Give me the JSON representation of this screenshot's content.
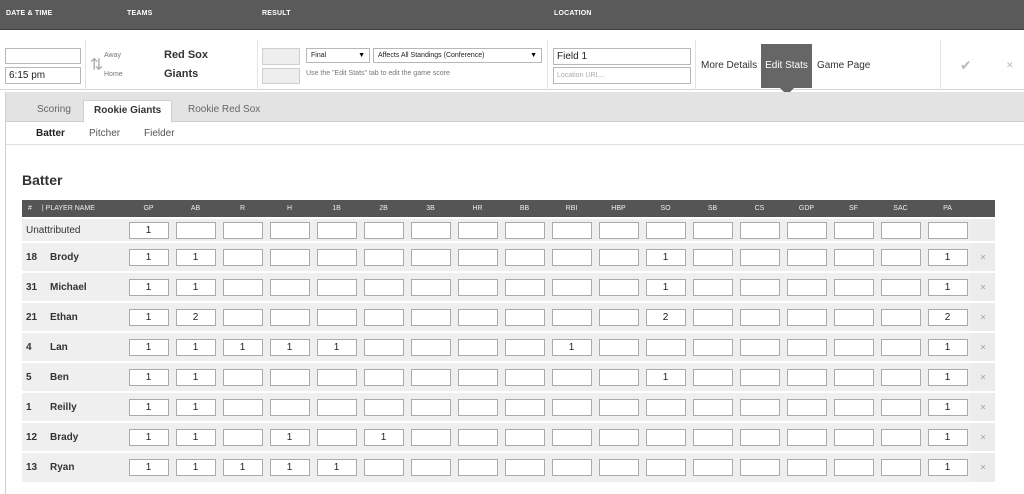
{
  "header": {
    "date_time": "DATE & TIME",
    "teams": "TEAMS",
    "result": "RESULT",
    "location": "LOCATION"
  },
  "game": {
    "date_value": "",
    "time_value": "6:15 pm",
    "away_label": "Away",
    "home_label": "Home",
    "away_team": "Red Sox",
    "home_team": "Giants",
    "status_select": "Final",
    "standings_select": "Affects All Standings (Conference)",
    "result_hint": "Use the \"Edit Stats\" tab to edit the game score",
    "location_value": "Field 1",
    "location_url_placeholder": "Location URL...",
    "more_details": "More Details",
    "edit_stats": "Edit Stats",
    "game_page": "Game Page",
    "icons": {
      "swap": "swap-icon",
      "save": "check-icon",
      "delete": "close-icon"
    }
  },
  "tabs": [
    "Scoring",
    "Rookie Giants",
    "Rookie Red Sox"
  ],
  "active_tab": "Rookie Giants",
  "subtabs": [
    "Batter",
    "Pitcher",
    "Fielder"
  ],
  "active_subtab": "Batter",
  "section_title": "Batter",
  "table": {
    "num_header": "#",
    "name_header": "| PLAYER NAME",
    "columns": [
      "GP",
      "AB",
      "R",
      "H",
      "1B",
      "2B",
      "3B",
      "HR",
      "BB",
      "RBI",
      "HBP",
      "SO",
      "SB",
      "CS",
      "GDP",
      "SF",
      "SAC",
      "PA"
    ],
    "rows": [
      {
        "num": "",
        "name": "Unattributed",
        "values": [
          "1",
          "",
          "",
          "",
          "",
          "",
          "",
          "",
          "",
          "",
          "",
          "",
          "",
          "",
          "",
          "",
          "",
          ""
        ],
        "deletable": false
      },
      {
        "num": "18",
        "name": "Brody",
        "values": [
          "1",
          "1",
          "",
          "",
          "",
          "",
          "",
          "",
          "",
          "",
          "",
          "1",
          "",
          "",
          "",
          "",
          "",
          "1"
        ],
        "deletable": true
      },
      {
        "num": "31",
        "name": "Michael",
        "values": [
          "1",
          "1",
          "",
          "",
          "",
          "",
          "",
          "",
          "",
          "",
          "",
          "1",
          "",
          "",
          "",
          "",
          "",
          "1"
        ],
        "deletable": true
      },
      {
        "num": "21",
        "name": "Ethan",
        "values": [
          "1",
          "2",
          "",
          "",
          "",
          "",
          "",
          "",
          "",
          "",
          "",
          "2",
          "",
          "",
          "",
          "",
          "",
          "2"
        ],
        "deletable": true
      },
      {
        "num": "4",
        "name": "Lan",
        "values": [
          "1",
          "1",
          "1",
          "1",
          "1",
          "",
          "",
          "",
          "",
          "1",
          "",
          "",
          "",
          "",
          "",
          "",
          "",
          "1"
        ],
        "deletable": true
      },
      {
        "num": "5",
        "name": "Ben",
        "values": [
          "1",
          "1",
          "",
          "",
          "",
          "",
          "",
          "",
          "",
          "",
          "",
          "1",
          "",
          "",
          "",
          "",
          "",
          "1"
        ],
        "deletable": true
      },
      {
        "num": "1",
        "name": "Reilly",
        "values": [
          "1",
          "1",
          "",
          "",
          "",
          "",
          "",
          "",
          "",
          "",
          "",
          "",
          "",
          "",
          "",
          "",
          "",
          "1"
        ],
        "deletable": true
      },
      {
        "num": "12",
        "name": "Brady",
        "values": [
          "1",
          "1",
          "",
          "1",
          "",
          "1",
          "",
          "",
          "",
          "",
          "",
          "",
          "",
          "",
          "",
          "",
          "",
          "1"
        ],
        "deletable": true
      },
      {
        "num": "13",
        "name": "Ryan",
        "values": [
          "1",
          "1",
          "1",
          "1",
          "1",
          "",
          "",
          "",
          "",
          "",
          "",
          "",
          "",
          "",
          "",
          "",
          "",
          "1"
        ],
        "deletable": true
      }
    ],
    "delete_icon": "close-icon"
  }
}
